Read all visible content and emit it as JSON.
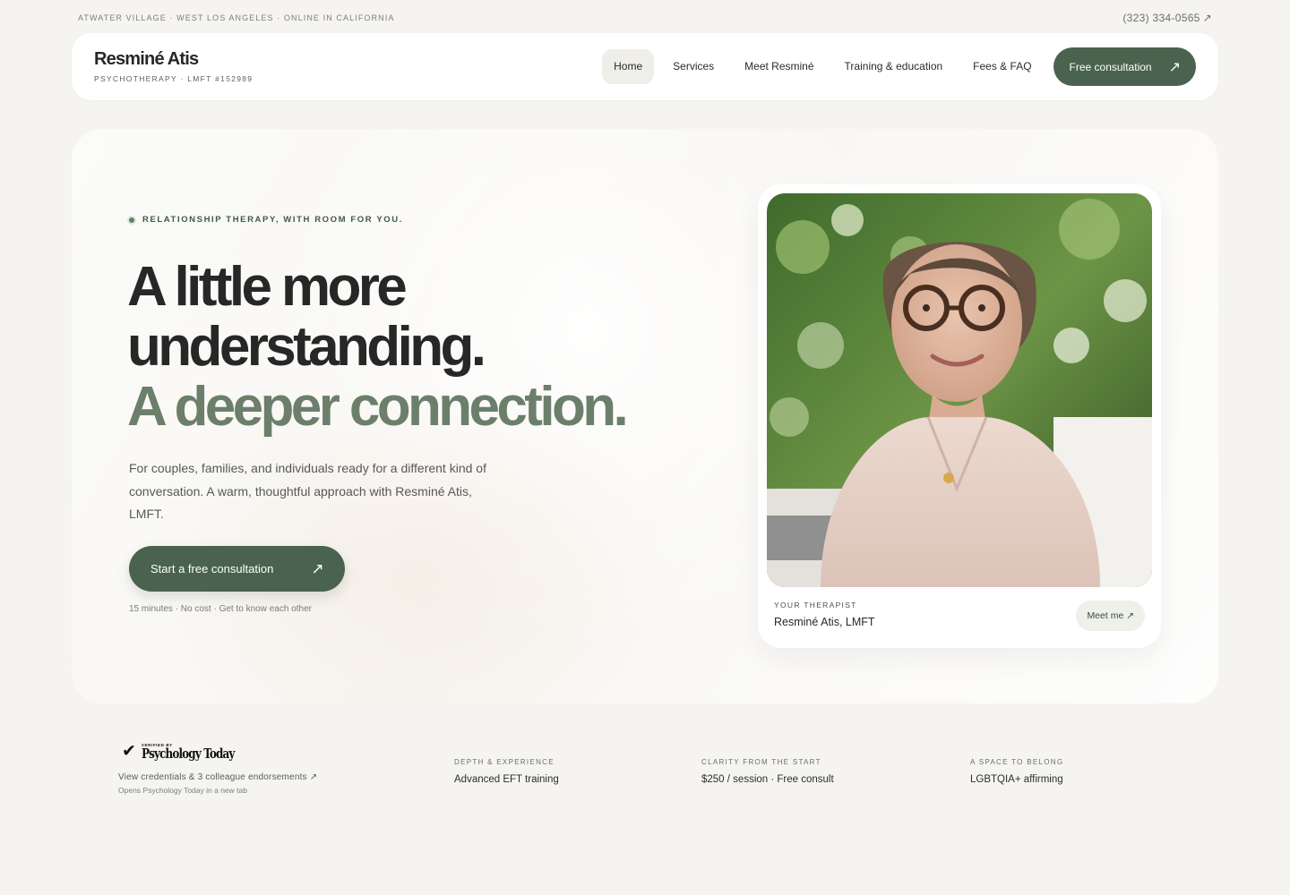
{
  "topbar": {
    "location": "ATWATER VILLAGE · WEST LOS ANGELES · ONLINE IN CALIFORNIA",
    "phone": "(323) 334-0565",
    "phone_icon": "↗"
  },
  "header": {
    "brand_name": "Resminé Atis",
    "brand_sub": "PSYCHOTHERAPY · LMFT #152989",
    "nav": [
      {
        "label": "Home",
        "active": true
      },
      {
        "label": "Services"
      },
      {
        "label": "Meet Resminé"
      },
      {
        "label": "Training & education"
      },
      {
        "label": "Fees & FAQ"
      }
    ],
    "cta_label": "Free consultation",
    "cta_icon": "↗"
  },
  "hero": {
    "eyebrow": "RELATIONSHIP THERAPY, WITH ROOM FOR YOU.",
    "headline_line1": "A little more",
    "headline_line2": "understanding.",
    "headline_line3": "A deeper connection.",
    "lede": "For couples, families, and individuals ready for a different kind of conversation. A warm, thoughtful approach with Resminé Atis, LMFT.",
    "cta_label": "Start a free consultation",
    "cta_icon": "↗",
    "meta": "15 minutes · No cost · Get to know each other",
    "card": {
      "label": "YOUR THERAPIST",
      "name": "Resminé Atis, LMFT",
      "button": "Meet me ↗"
    }
  },
  "badges": {
    "pt_verified": "VERIFIED BY",
    "pt_name": "Psychology Today",
    "pt_check": "✔",
    "pt_link": "View credentials & 3 colleague endorsements ↗",
    "pt_note": "Opens Psychology Today in a new tab",
    "items": [
      {
        "label": "DEPTH & EXPERIENCE",
        "value": "Advanced EFT training"
      },
      {
        "label": "CLARITY FROM THE START",
        "value": "$250 / session · Free consult"
      },
      {
        "label": "A SPACE TO BELONG",
        "value": "LGBTQIA+ affirming"
      }
    ]
  },
  "colors": {
    "accent": "#49634e",
    "headline_muted": "#6b7f6b",
    "background": "#f5f4f0"
  }
}
